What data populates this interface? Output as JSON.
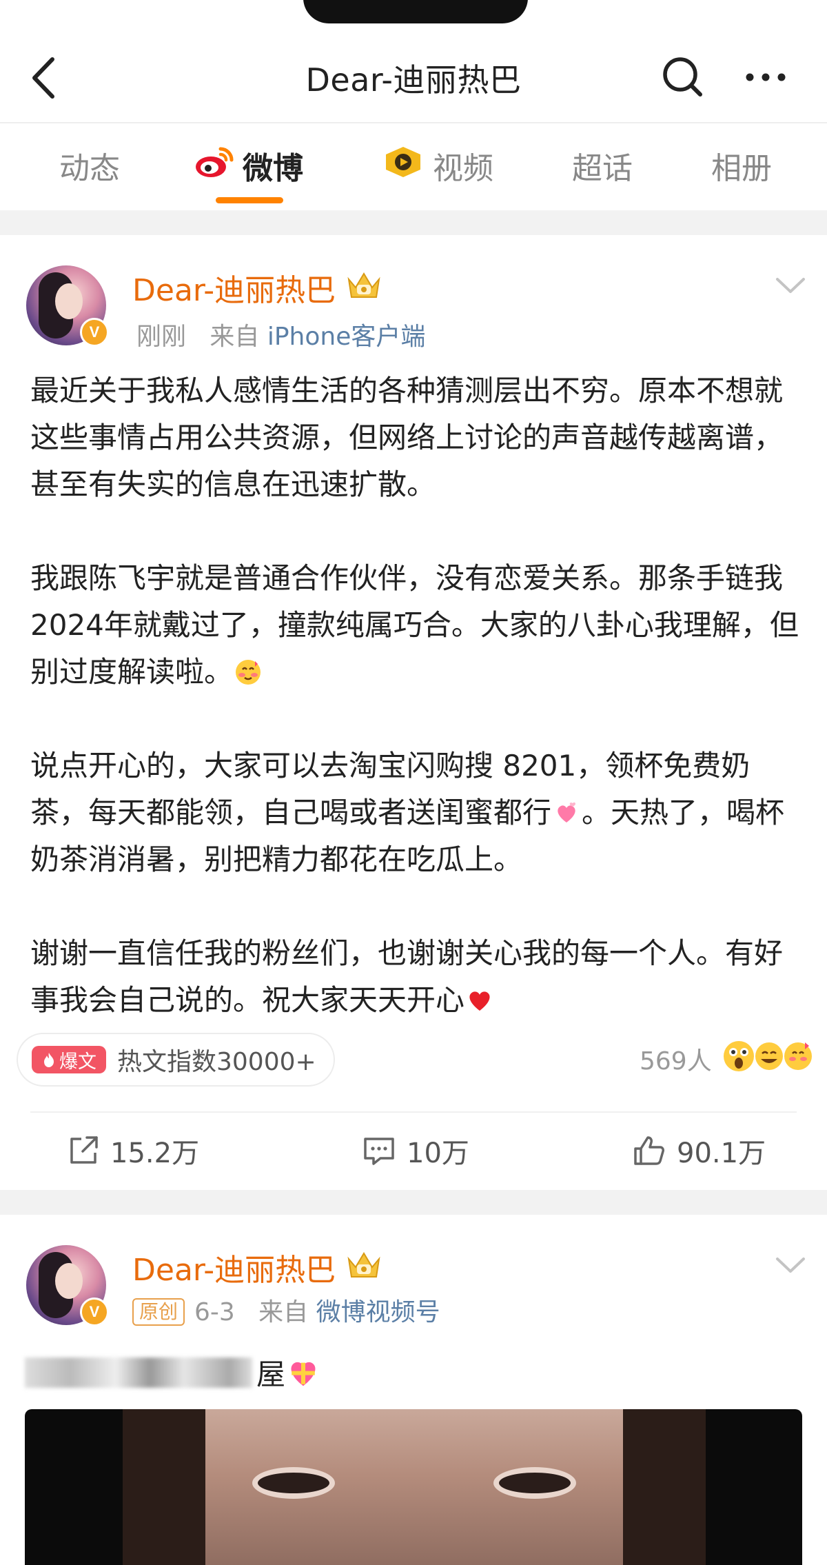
{
  "header": {
    "title": "Dear-迪丽热巴"
  },
  "tabs": [
    {
      "label": "动态"
    },
    {
      "label": "微博"
    },
    {
      "label": "视频"
    },
    {
      "label": "超话"
    },
    {
      "label": "相册"
    }
  ],
  "colors": {
    "accent": "#ff8200",
    "username": "#e86b0c",
    "source_link": "#5b7fa6",
    "hot_tag": "#f25564"
  },
  "post1": {
    "username": "Dear-迪丽热巴",
    "time": "刚刚",
    "source_prefix": "来自",
    "source": "iPhone客户端",
    "paragraphs": [
      "最近关于我私人感情生活的各种猜测层出不穷。原本不想就这些事情占用公共资源，但网络上讨论的声音越传越离谱，甚至有失实的信息在迅速扩散。",
      "我跟陈飞宇就是普通合作伙伴，没有恋爱关系。那条手链我2024年就戴过了，撞款纯属巧合。大家的八卦心我理解，但别过度解读啦。",
      "说点开心的，大家可以去淘宝闪购搜 8201，领杯免费奶茶，每天都能领，自己喝或者送闺蜜都行",
      "。天热了，喝杯奶茶消消暑，别把精力都花在吃瓜上。",
      "谢谢一直信任我的粉丝们，也谢谢关心我的每一个人。有好事我会自己说的。祝大家天天开心"
    ],
    "hot_tag": "爆文",
    "hot_text": "热文指数30000+",
    "reaction_count": "569人",
    "actions": {
      "repost": "15.2万",
      "comment": "10万",
      "like": "90.1万"
    }
  },
  "post2": {
    "username": "Dear-迪丽热巴",
    "label": "原创",
    "date": "6-3",
    "source_prefix": "来自",
    "source": "微博视频号",
    "text_visible": "屋"
  }
}
